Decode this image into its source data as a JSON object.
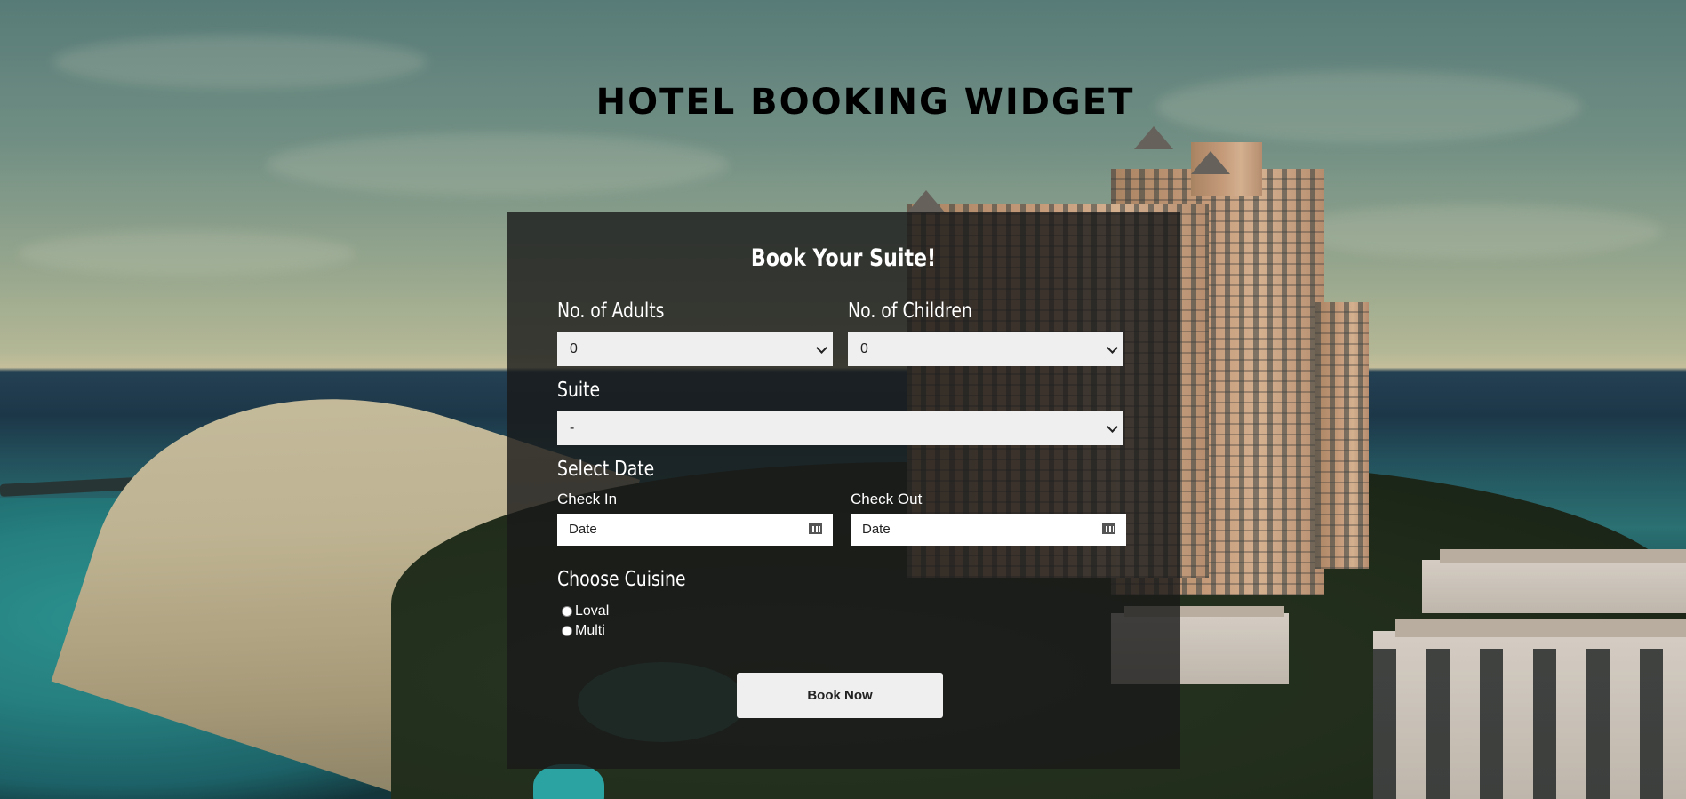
{
  "page": {
    "title": "HOTEL BOOKING WIDGET"
  },
  "form": {
    "title": "Book Your Suite!",
    "adults": {
      "label": "No. of Adults",
      "selected": "0"
    },
    "children": {
      "label": "No. of Children",
      "selected": "0"
    },
    "suite": {
      "label": "Suite",
      "selected": "-"
    },
    "date": {
      "label": "Select Date",
      "check_in": {
        "label": "Check In",
        "placeholder": "Date"
      },
      "check_out": {
        "label": "Check Out",
        "placeholder": "Date"
      }
    },
    "cuisine": {
      "label": "Choose Cuisine",
      "options": [
        "Loval",
        "Multi"
      ]
    },
    "submit_label": "Book Now"
  },
  "icons": {
    "select_arrow": "chevron-down-icon",
    "date_picker": "calendar-icon"
  },
  "colors": {
    "panel_bg": "#191919",
    "input_bg": "#efefef",
    "title_text": "#000000",
    "panel_text": "#ffffff"
  }
}
